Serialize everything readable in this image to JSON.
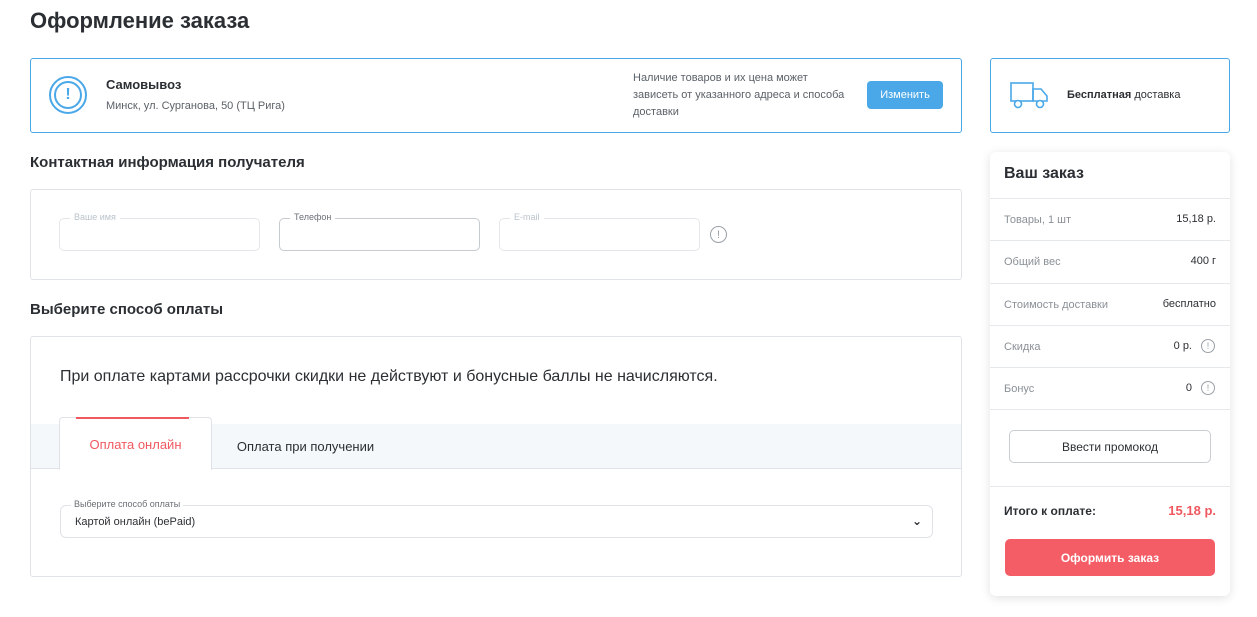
{
  "page": {
    "title": "Оформление заказа"
  },
  "pickup": {
    "title": "Самовывоз",
    "address": "Минск, ул. Сурганова, 50 (ТЦ Рига)",
    "note": "Наличие товаров и их цена может зависеть от указанного адреса и способа доставки",
    "change_label": "Изменить",
    "icon": "info-circle-icon"
  },
  "delivery": {
    "bold": "Бесплатная",
    "rest": " доставка",
    "icon": "truck-icon"
  },
  "contact": {
    "title": "Контактная информация получателя",
    "fields": [
      {
        "label": "Ваше имя",
        "value": ""
      },
      {
        "label": "Телефон",
        "value": ""
      },
      {
        "label": "E-mail",
        "value": ""
      }
    ]
  },
  "payment": {
    "title": "Выберите способ оплаты",
    "warning": "При оплате картами рассрочки скидки не действуют и бонусные баллы не начисляются.",
    "tabs": [
      {
        "label": "Оплата онлайн",
        "active": true
      },
      {
        "label": "Оплата при получении",
        "active": false
      }
    ],
    "select": {
      "label": "Выберите способ оплаты",
      "value": "Картой онлайн (bePaid)"
    }
  },
  "summary": {
    "title": "Ваш заказ",
    "rows": [
      {
        "key": "Товары, 1 шт",
        "value": "15,18 р."
      },
      {
        "key": "Общий вес",
        "value": "400 г"
      },
      {
        "key": "Стоимость доставки",
        "value": "бесплатно"
      },
      {
        "key": "Скидка",
        "value": "0 р."
      },
      {
        "key": "Бонус",
        "value": "0"
      }
    ],
    "promo_label": "Ввести промокод",
    "total_label": "Итого к оплате:",
    "total_value": "15,18 р.",
    "order_label": "Оформить заказ"
  },
  "colors": {
    "accent_blue": "#4aa8e8",
    "accent_red": "#f0585f"
  }
}
